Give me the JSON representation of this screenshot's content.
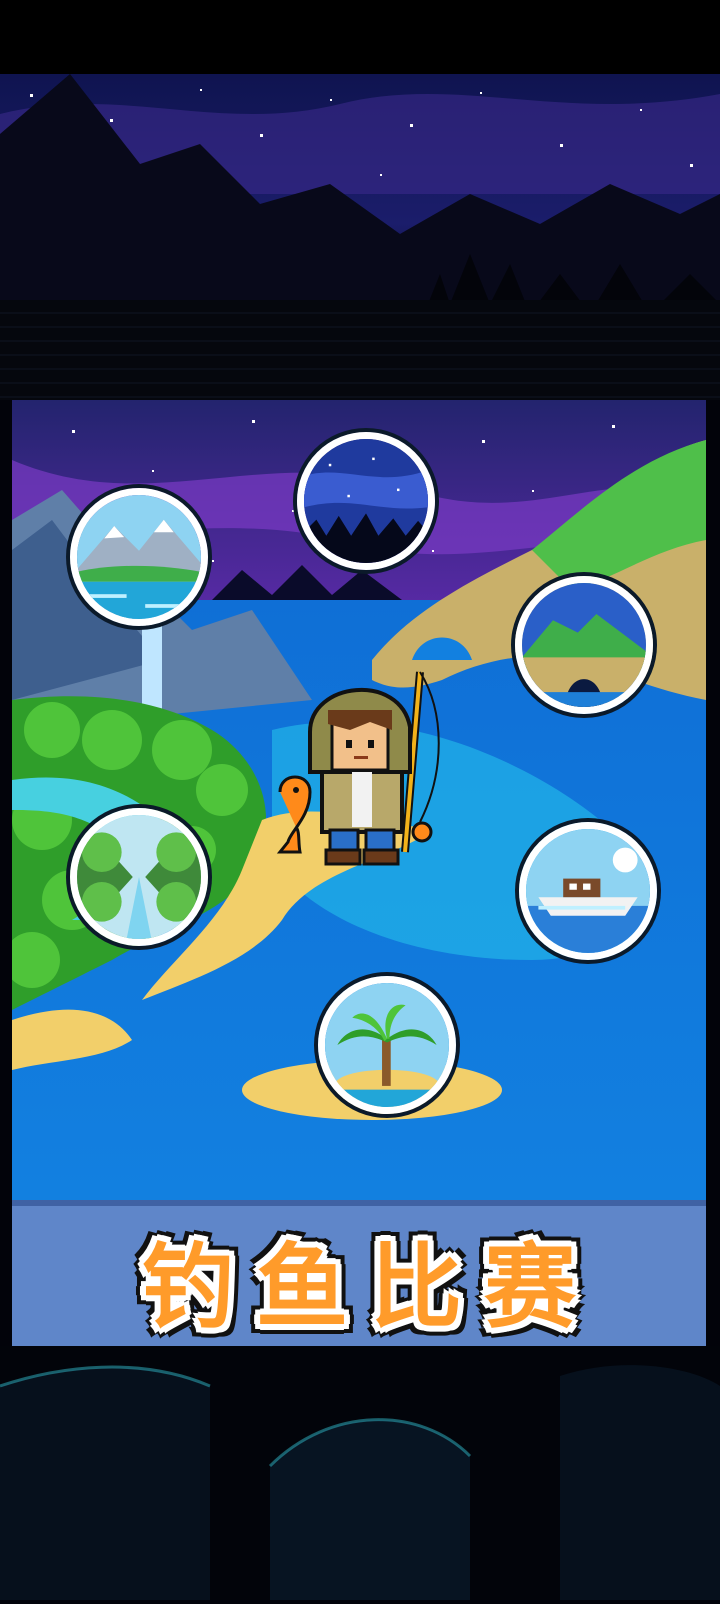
{
  "title": "钓鱼比赛",
  "colors": {
    "title_fill": "#ff9b2a",
    "title_bar": "#5f86c9",
    "sea": "#1a8fe0",
    "sky": "#2a1f6e"
  },
  "locations": [
    {
      "name": "mountain-lake",
      "icon": "mountain-lake-icon"
    },
    {
      "name": "night-sky",
      "icon": "night-forest-icon"
    },
    {
      "name": "sea-cave",
      "icon": "sea-cave-icon"
    },
    {
      "name": "forest-river",
      "icon": "forest-river-icon"
    },
    {
      "name": "open-sea-boat",
      "icon": "boat-icon"
    },
    {
      "name": "palm-island",
      "icon": "palm-island-icon"
    }
  ],
  "character": {
    "name": "fisherman",
    "icon": "fisherman-icon"
  }
}
